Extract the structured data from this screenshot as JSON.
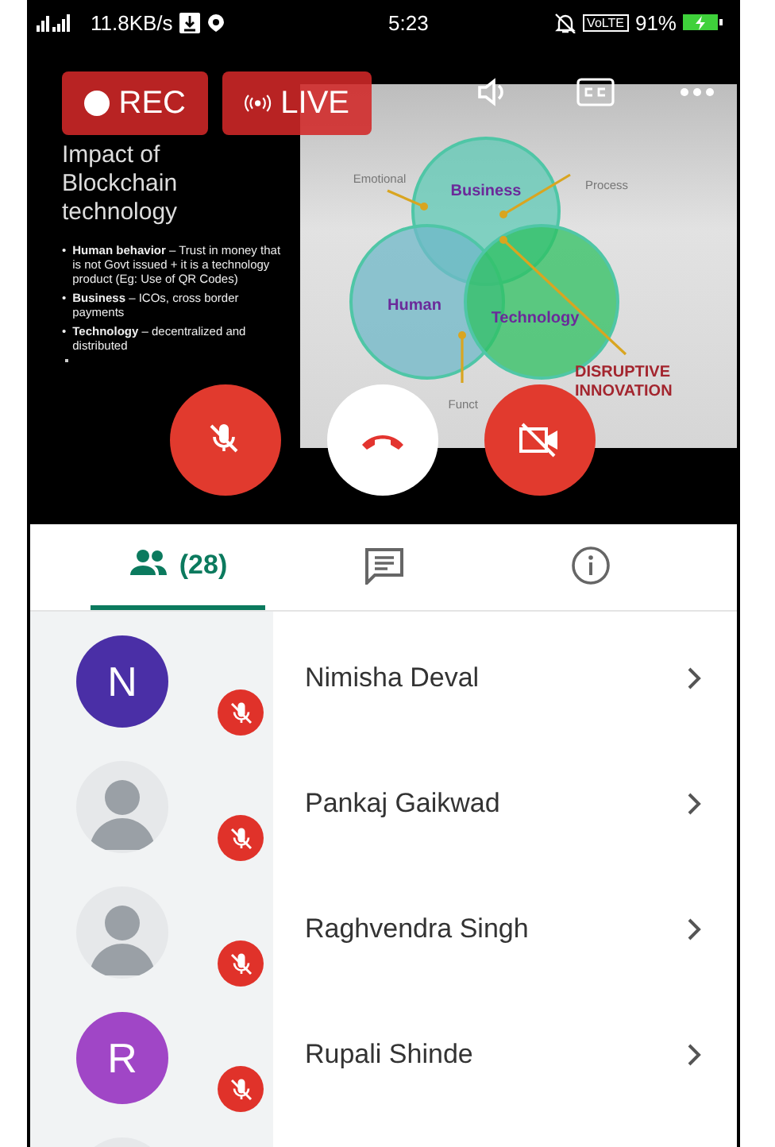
{
  "status_bar": {
    "network_speed": "11.8KB/s",
    "time": "5:23",
    "volte": "VoLTE",
    "battery": "91%"
  },
  "call": {
    "rec": "REC",
    "live": "LIVE",
    "mic_muted": true,
    "camera_off": true
  },
  "slide": {
    "title": "Impact of Blockchain technology",
    "bullets": [
      "**Human behavior** – Trust in money that is not Govt issued + it is a technology product (Eg: Use of QR Codes)",
      "**Business** – ICOs, cross border payments",
      "**Technology** – decentralized and distributed"
    ],
    "circles": [
      "Business",
      "Human",
      "Technology"
    ],
    "outer_labels": [
      "Emotional",
      "Process",
      "Funct"
    ],
    "marker": "•",
    "callout": "DISRUPTIVE INNOVATION"
  },
  "tabs": [
    {
      "kind": "people",
      "label": "(28)",
      "selected": true
    },
    {
      "kind": "chat",
      "selected": false
    },
    {
      "kind": "info",
      "selected": false
    }
  ],
  "participants": [
    {
      "name": "Nimisha Deval",
      "kind": "letter",
      "initial": "N",
      "color": "#4a2fa6",
      "muted": true
    },
    {
      "name": "Pankaj Gaikwad",
      "kind": "photo",
      "muted": true
    },
    {
      "name": "Raghvendra Singh",
      "kind": "photo",
      "muted": true
    },
    {
      "name": "Rupali Shinde",
      "kind": "letter",
      "initial": "R",
      "color": "#a046c6",
      "muted": true
    },
    {
      "kind": "photo"
    }
  ]
}
